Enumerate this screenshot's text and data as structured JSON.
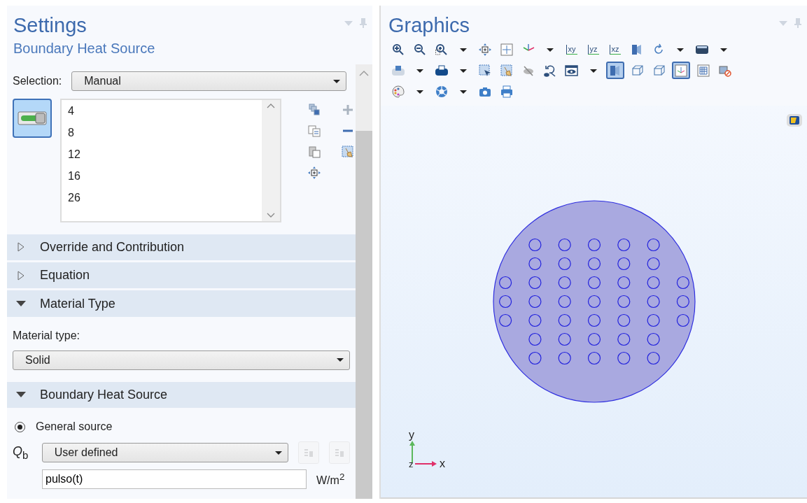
{
  "settings": {
    "title": "Settings",
    "subtitle": "Boundary Heat Source",
    "selection_label": "Selection:",
    "selection_value": "Manual",
    "active_toggle": {
      "selected": true
    },
    "boundaries": [
      "4",
      "8",
      "12",
      "16",
      "26"
    ]
  },
  "sections": [
    {
      "title": "Override and Contribution",
      "expanded": false
    },
    {
      "title": "Equation",
      "expanded": false
    },
    {
      "title": "Material Type",
      "expanded": true,
      "kind": "material",
      "label": "Material type:",
      "value": "Solid"
    },
    {
      "title": "Boundary Heat Source",
      "expanded": true,
      "kind": "source",
      "radio": {
        "label": "General source",
        "selected": true
      },
      "symbol": "*Q*$_{b}$",
      "source_value": "User defined",
      "buttons": [
        {
          "disabled": true
        },
        {
          "disabled": true
        }
      ],
      "expression": "pulso(t)",
      "unit": "W/m$^{2}$"
    }
  ],
  "graphics": {
    "title": "Graphics",
    "toolbar": [
      [
        {
          "selected": false
        },
        {
          "selected": false
        },
        {
          "selected": false
        },
        {
          "selected": false
        },
        {
          "selected": false
        },
        {
          "selected": false
        },
        {
          "selected": false,
          "text": "xy"
        },
        {
          "selected": false,
          "text": "yz"
        },
        {
          "selected": false,
          "text": "xz"
        },
        {
          "selected": false
        },
        {
          "selected": false
        },
        {
          "selected": false
        }
      ],
      [
        {
          "selected": false
        },
        {
          "selected": false
        },
        {
          "selected": false
        },
        {
          "selected": false
        },
        {
          "selected": false
        },
        {
          "selected": false
        },
        {
          "selected": false
        },
        {
          "selected": true
        },
        {
          "selected": false
        },
        {
          "selected": false
        },
        {
          "selected": true
        },
        {
          "selected": false
        },
        {
          "selected": false
        }
      ],
      [
        {
          "selected": false
        },
        {
          "selected": false
        },
        {
          "selected": false
        },
        {
          "selected": false
        }
      ]
    ],
    "axes": {
      "x": "x",
      "y": "y",
      "z": "z"
    }
  }
}
